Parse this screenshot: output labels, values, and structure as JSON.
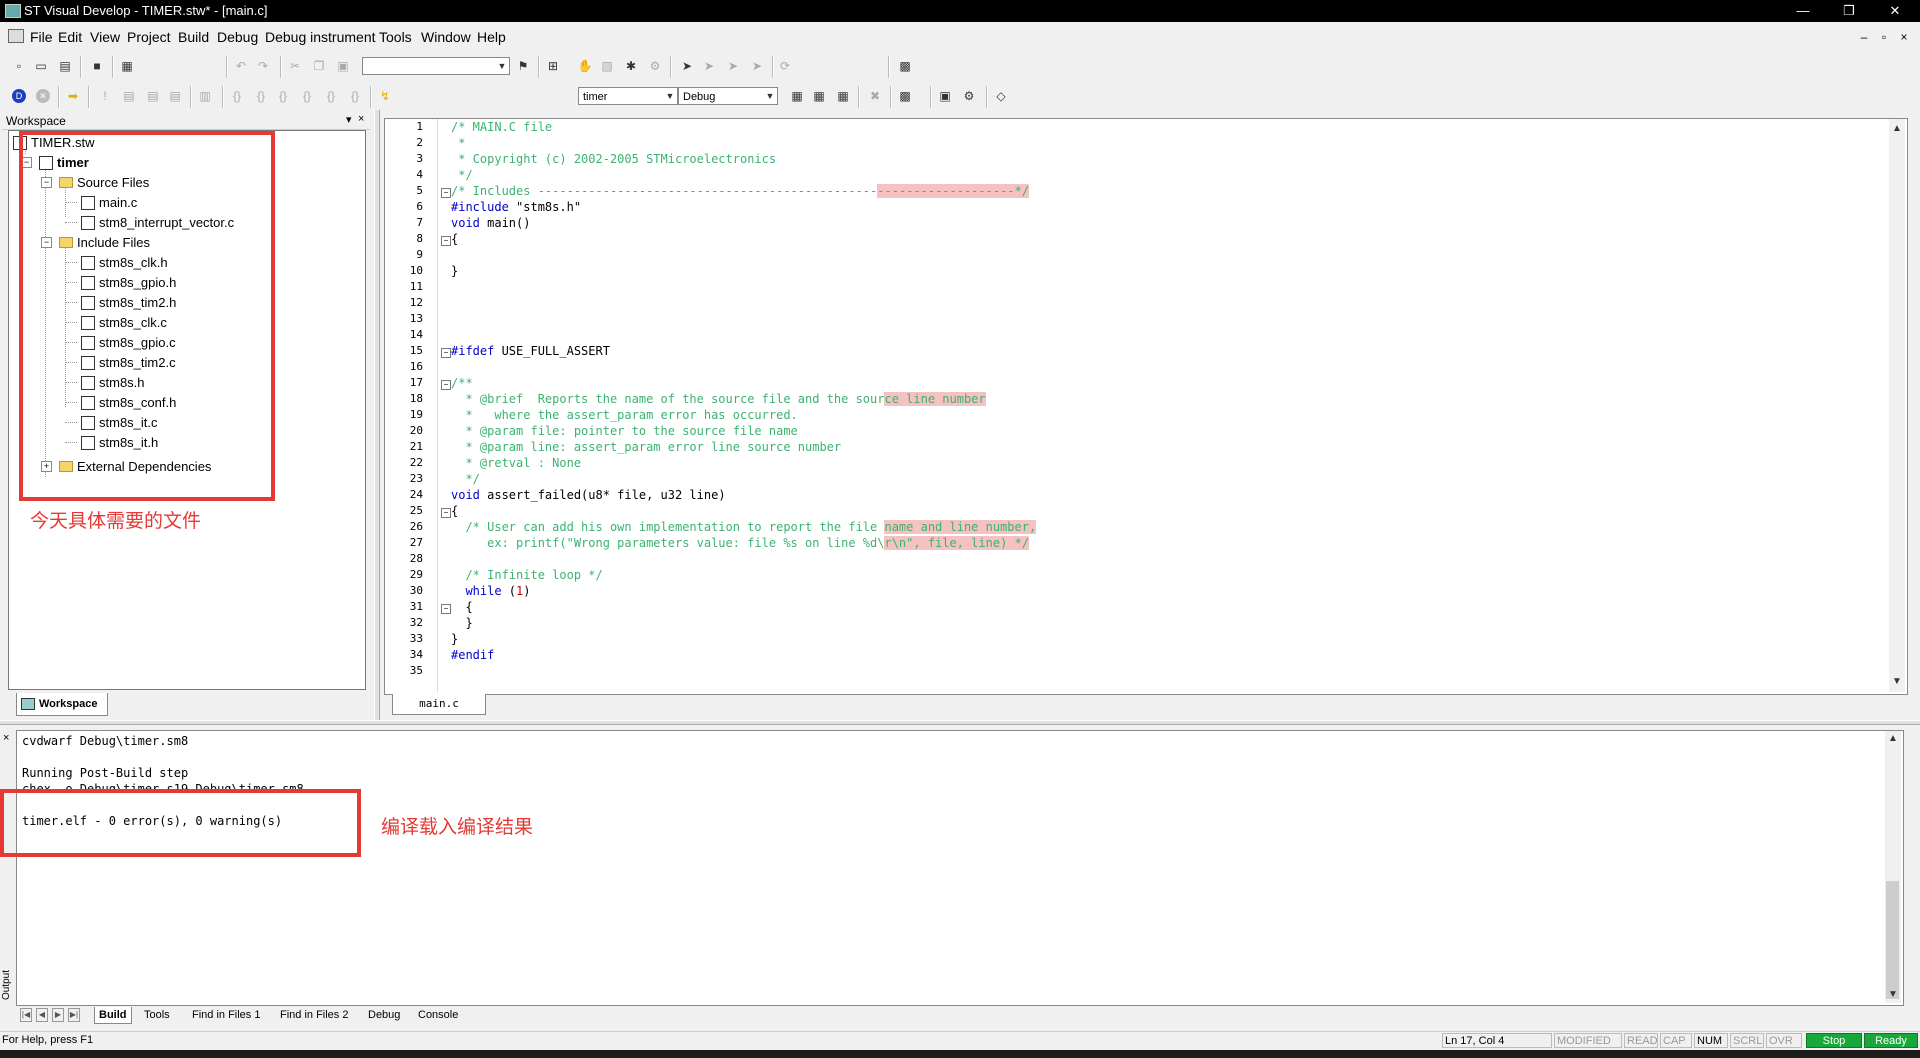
{
  "window": {
    "title": "ST Visual Develop - TIMER.stw* - [main.c]",
    "minimize": "—",
    "restore": "❐",
    "close": "✕"
  },
  "menu": [
    "File",
    "Edit",
    "View",
    "Project",
    "Build",
    "Debug",
    "Debug instrument",
    "Tools",
    "Window",
    "Help"
  ],
  "mdi_controls": [
    "–",
    "▫",
    "×"
  ],
  "toolbar": {
    "find_combo_value": "",
    "project_combo_value": "timer",
    "config_combo_value": "Debug"
  },
  "workspace": {
    "header": "Workspace",
    "pin": "▾",
    "close": "×",
    "tab_label": "Workspace",
    "root": "TIMER.stw",
    "project": "timer",
    "source_folder": "Source Files",
    "source_files": [
      "main.c",
      "stm8_interrupt_vector.c"
    ],
    "include_folder": "Include Files",
    "include_files": [
      "stm8s_clk.h",
      "stm8s_gpio.h",
      "stm8s_tim2.h",
      "stm8s_clk.c",
      "stm8s_gpio.c",
      "stm8s_tim2.c",
      "stm8s.h",
      "stm8s_conf.h",
      "stm8s_it.c",
      "stm8s_it.h"
    ],
    "external_folder": "External Dependencies"
  },
  "annotations": {
    "files_note": "今天具体需要的文件",
    "build_note": "编译载入编译结果"
  },
  "editor": {
    "tab_label": "main.c",
    "line_numbers": [
      "1",
      "2",
      "3",
      "4",
      "5",
      "6",
      "7",
      "8",
      "9",
      "10",
      "11",
      "12",
      "13",
      "14",
      "15",
      "16",
      "17",
      "18",
      "19",
      "20",
      "21",
      "22",
      "23",
      "24",
      "25",
      "26",
      "27",
      "28",
      "29",
      "30",
      "31",
      "32",
      "33",
      "34",
      "35"
    ],
    "code": [
      "/* MAIN.C file",
      " *",
      " * Copyright (c) 2002-2005 STMicroelectronics",
      " */",
      "/* Includes ------------------------------------------------------------------*/",
      "#include \"stm8s.h\"",
      "void main()",
      "{",
      "",
      "}",
      "",
      "",
      "",
      "",
      "#ifdef USE_FULL_ASSERT",
      "",
      "/**",
      "  * @brief  Reports the name of the source file and the source line number",
      "  *   where the assert_param error has occurred.",
      "  * @param file: pointer to the source file name",
      "  * @param line: assert_param error line source number",
      "  * @retval : None",
      "  */",
      "void assert_failed(u8* file, u32 line)",
      "{",
      "  /* User can add his own implementation to report the file name and line number,",
      "     ex: printf(\"Wrong parameters value: file %s on line %d\\r\\n\", file, line) */",
      "",
      "  /* Infinite loop */",
      "  while (1)",
      "  {",
      "  }",
      "}",
      "#endif",
      ""
    ]
  },
  "output": {
    "lines": [
      "cvdwarf Debug\\timer.sm8",
      "",
      "Running Post-Build step",
      "chex -o Debug\\timer.s19 Debug\\timer.sm8",
      "",
      "timer.elf - 0 error(s), 0 warning(s)"
    ],
    "side_label": "Output",
    "close": "×",
    "tabs": [
      "Build",
      "Tools",
      "Find in Files 1",
      "Find in Files 2",
      "Debug",
      "Console"
    ]
  },
  "status": {
    "help": "For Help, press F1",
    "position": "Ln 17, Col 4",
    "modified": "MODIFIED",
    "read": "READ",
    "cap": "CAP",
    "num": "NUM",
    "scrl": "SCRL",
    "ovr": "OVR",
    "stop": "Stop",
    "ready": "Ready"
  },
  "colors": {
    "comment": "#3cb371",
    "keyword": "#0000cc",
    "annotation_red": "#e53935",
    "status_green": "#18a83a"
  }
}
